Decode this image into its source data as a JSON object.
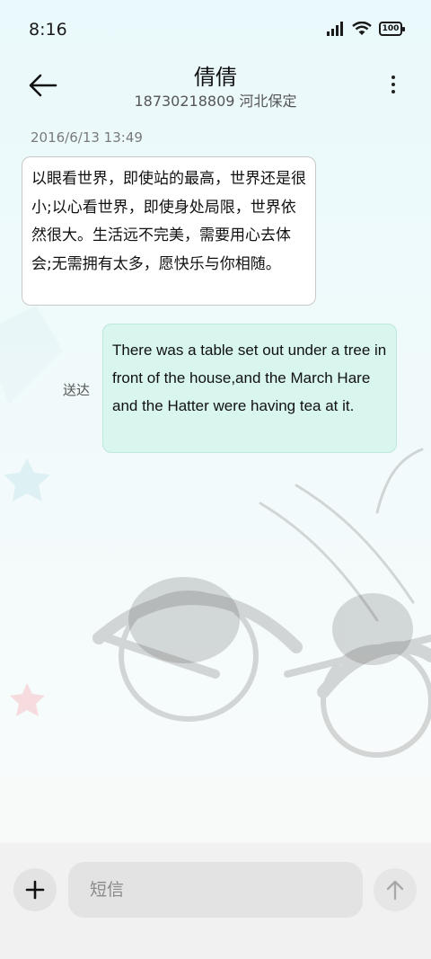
{
  "status_bar": {
    "time": "8:16",
    "battery": "100",
    "icons": [
      "signal-icon",
      "wifi-icon",
      "battery-icon"
    ]
  },
  "header": {
    "contact_name": "倩倩",
    "contact_sub": "18730218809 河北保定"
  },
  "conversation": {
    "timestamp": "2016/6/13 13:49",
    "incoming": {
      "text": "以眼看世界，即使站的最高，世界还是很小;以心看世界，即使身处局限，世界依然很大。生活远不完美，需要用心去体会;无需拥有太多，愿快乐与你相随。"
    },
    "outgoing": {
      "text": "There was a table set out under a tree in front of the house,and the March Hare and the Hatter were having tea at it.",
      "status": "送达"
    }
  },
  "composer": {
    "placeholder": "短信"
  },
  "colors": {
    "outgoing_bubble": "#d8f5ee",
    "incoming_bubble": "#ffffff",
    "background_top": "#eaf9fb"
  }
}
